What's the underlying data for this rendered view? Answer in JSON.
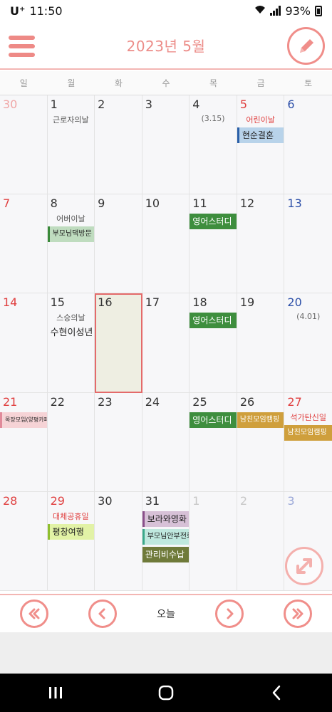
{
  "status_bar": {
    "carrier": "U⁺",
    "time": "11:50",
    "battery": "93%"
  },
  "header": {
    "title": "2023년 5월"
  },
  "colors": {
    "accent": "#f08e8a",
    "sunday": "#e04040",
    "saturday": "#2c4fa8",
    "today_border": "#e46a6a"
  },
  "weekdays": [
    "일",
    "월",
    "화",
    "수",
    "목",
    "금",
    "토"
  ],
  "days": [
    {
      "num": "30",
      "style": "other"
    },
    {
      "num": "1",
      "holiday": "근로자의날"
    },
    {
      "num": "2"
    },
    {
      "num": "3"
    },
    {
      "num": "4",
      "lunar": "(3.15)"
    },
    {
      "num": "5",
      "style": "sun",
      "holiday": "어린이날",
      "holiday_red": true,
      "events": [
        {
          "text": "현순결혼",
          "bg": "#b8d3ea",
          "bar": "#2a5fa8"
        }
      ]
    },
    {
      "num": "6",
      "style": "sat"
    },
    {
      "num": "7",
      "style": "sun"
    },
    {
      "num": "8",
      "holiday": "어버이날",
      "events": [
        {
          "text": "부모님댁방문",
          "bg": "#bfdcbf",
          "bar": "#3a8a3a",
          "small": true
        }
      ]
    },
    {
      "num": "9"
    },
    {
      "num": "10"
    },
    {
      "num": "11",
      "events": [
        {
          "text": "영어스터디",
          "bg": "#3e8e3e",
          "color": "#ffffff"
        }
      ]
    },
    {
      "num": "12"
    },
    {
      "num": "13",
      "style": "sat"
    },
    {
      "num": "14",
      "style": "sun"
    },
    {
      "num": "15",
      "holiday": "스승의날",
      "events": [
        {
          "text": "수현이성년",
          "plain": true
        }
      ]
    },
    {
      "num": "16",
      "today": true
    },
    {
      "num": "17"
    },
    {
      "num": "18",
      "events": [
        {
          "text": "영어스터디",
          "bg": "#3e8e3e",
          "color": "#ffffff"
        }
      ]
    },
    {
      "num": "19"
    },
    {
      "num": "20",
      "style": "sat",
      "lunar": "(4.01)"
    },
    {
      "num": "21",
      "style": "sun",
      "events": [
        {
          "text": "목장모임(양평카페)",
          "bg": "#f6d3d6",
          "bar": "#e08a9a",
          "tiny": true
        }
      ]
    },
    {
      "num": "22"
    },
    {
      "num": "23"
    },
    {
      "num": "24"
    },
    {
      "num": "25",
      "events": [
        {
          "text": "영어스터디",
          "bg": "#3e8e3e",
          "color": "#ffffff"
        }
      ]
    },
    {
      "num": "26",
      "events": [
        {
          "text": "남친모임캠핑",
          "bg": "#cf9f3c",
          "color": "#ffffff",
          "small": true
        }
      ]
    },
    {
      "num": "27",
      "style": "sun",
      "holiday": "석가탄신일",
      "holiday_red": true,
      "events": [
        {
          "text": "남친모임캠핑",
          "bg": "#cf9f3c",
          "color": "#ffffff",
          "small": true
        }
      ]
    },
    {
      "num": "28",
      "style": "sun"
    },
    {
      "num": "29",
      "style": "sun",
      "holiday": "대체공휴일",
      "holiday_red": true,
      "events": [
        {
          "text": "평창여행",
          "bg": "#e2f2a6",
          "bar": "#8fbf2f"
        }
      ]
    },
    {
      "num": "30"
    },
    {
      "num": "31",
      "events": [
        {
          "text": "보라와영화",
          "bg": "#d7c1d7",
          "bar": "#8a4f8a"
        },
        {
          "text": "부모님안부전화",
          "bg": "#bfe8de",
          "bar": "#3aa88a",
          "small": true
        },
        {
          "text": "관리비수납",
          "bg": "#6f7a3a",
          "color": "#ffffff"
        }
      ]
    },
    {
      "num": "1",
      "style": "other-gray"
    },
    {
      "num": "2",
      "style": "other-gray"
    },
    {
      "num": "3",
      "style": "other-blue"
    }
  ],
  "nav": {
    "today_label": "오늘"
  },
  "icons": {
    "menu": "hamburger-icon",
    "edit": "pencil-icon",
    "expand": "expand-icon",
    "first": "double-chevron-left-icon",
    "prev": "chevron-left-icon",
    "next": "chevron-right-icon",
    "last": "double-chevron-right-icon"
  }
}
